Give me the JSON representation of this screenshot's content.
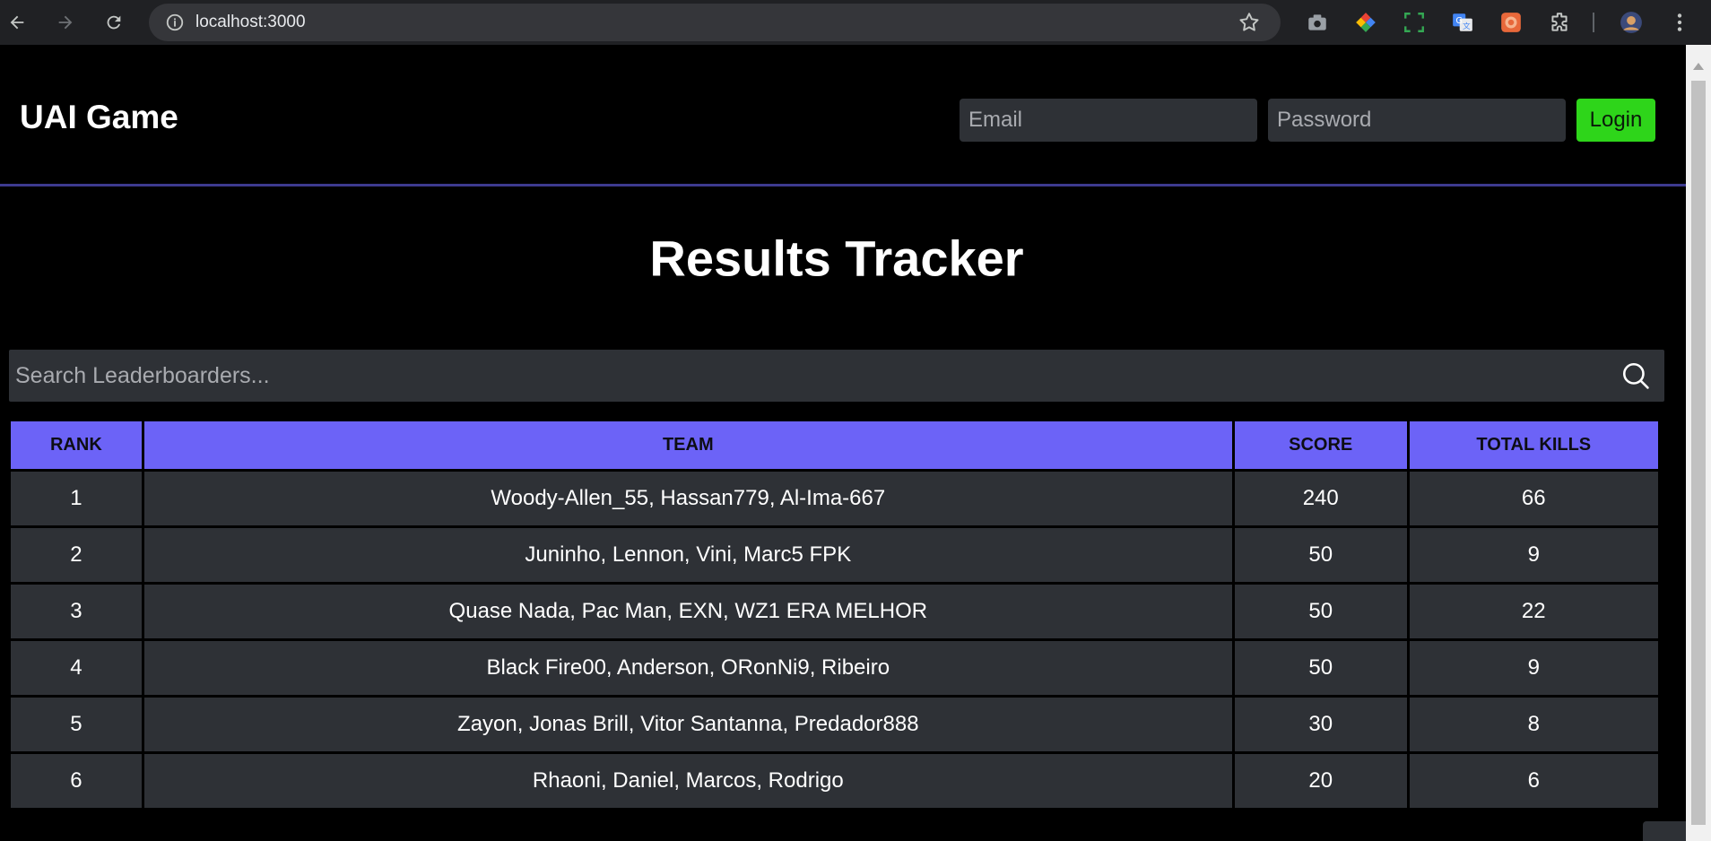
{
  "browser": {
    "url": "localhost:3000"
  },
  "header": {
    "app_title": "UAI Game",
    "email_placeholder": "Email",
    "password_placeholder": "Password",
    "login_label": "Login",
    "accent_color": "#2ed51a"
  },
  "main": {
    "title": "Results Tracker",
    "search_placeholder": "Search Leaderboarders...",
    "table": {
      "header_color": "#6c63f7",
      "columns": [
        "RANK",
        "TEAM",
        "SCORE",
        "TOTAL KILLS"
      ],
      "rows": [
        {
          "rank": "1",
          "team": "Woody-Allen_55, Hassan779, Al-Ima-667",
          "score": "240",
          "kills": "66"
        },
        {
          "rank": "2",
          "team": "Juninho, Lennon, Vini, Marc5 FPK",
          "score": "50",
          "kills": "9"
        },
        {
          "rank": "3",
          "team": "Quase Nada, Pac Man, EXN, WZ1 ERA MELHOR",
          "score": "50",
          "kills": "22"
        },
        {
          "rank": "4",
          "team": "Black Fire00, Anderson, ORonNi9, Ribeiro",
          "score": "50",
          "kills": "9"
        },
        {
          "rank": "5",
          "team": "Zayon, Jonas Brill, Vitor Santanna, Predador888",
          "score": "30",
          "kills": "8"
        },
        {
          "rank": "6",
          "team": "Rhaoni, Daniel, Marcos, Rodrigo",
          "score": "20",
          "kills": "6"
        }
      ]
    }
  }
}
